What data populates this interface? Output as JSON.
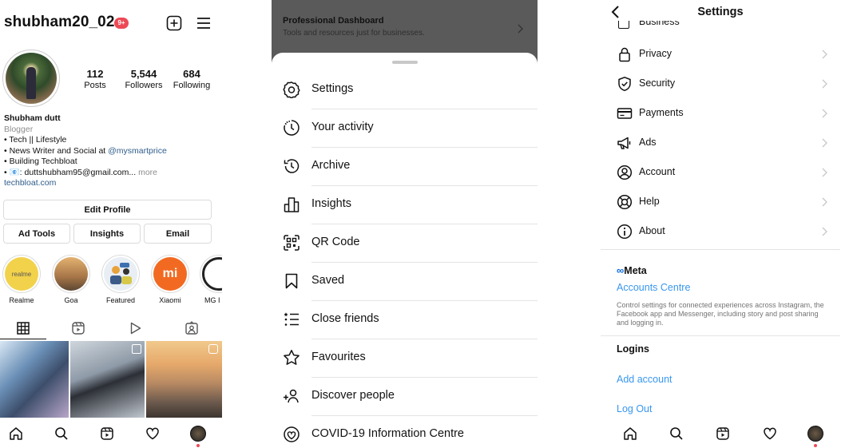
{
  "profile": {
    "username": "shubham20_02",
    "notification_badge": "9+",
    "stats": [
      {
        "value": "112",
        "label": "Posts"
      },
      {
        "value": "5,544",
        "label": "Followers"
      },
      {
        "value": "684",
        "label": "Following"
      }
    ],
    "bio": {
      "name": "Shubham dutt",
      "category": "Blogger",
      "line1": "• Tech || Lifestyle",
      "line2_prefix": "• News Writer and Social at ",
      "line2_mention": "@mysmartprice",
      "line3": "• Building Techbloat",
      "line4": "• 📧: duttshubham95@gmail.com...",
      "line4_more": " more",
      "link": "techbloat.com"
    },
    "buttons": {
      "edit_profile": "Edit Profile",
      "ad_tools": "Ad Tools",
      "insights": "Insights",
      "email": "Email"
    },
    "highlights": [
      {
        "label": "Realme",
        "color": "#f2d24b"
      },
      {
        "label": "Goa",
        "color": "#c98b4a"
      },
      {
        "label": "Featured",
        "color": "#e8eef4"
      },
      {
        "label": "Xiaomi",
        "color": "#f26a21"
      },
      {
        "label": "MG I",
        "color": "#222222"
      }
    ],
    "realme_logo_text": "realme",
    "xiaomi_logo_text": "mi"
  },
  "menu": {
    "dim_title": "Professional Dashboard",
    "dim_subtitle": "Tools and resources just for businesses.",
    "items": [
      {
        "label": "Settings",
        "icon": "settings-icon"
      },
      {
        "label": "Your activity",
        "icon": "activity-icon"
      },
      {
        "label": "Archive",
        "icon": "archive-icon"
      },
      {
        "label": "Insights",
        "icon": "insights-icon"
      },
      {
        "label": "QR Code",
        "icon": "qr-code-icon"
      },
      {
        "label": "Saved",
        "icon": "saved-icon"
      },
      {
        "label": "Close friends",
        "icon": "close-friends-icon"
      },
      {
        "label": "Favourites",
        "icon": "star-icon"
      },
      {
        "label": "Discover people",
        "icon": "add-person-icon"
      },
      {
        "label": "COVID-19 Information Centre",
        "icon": "covid-info-icon"
      }
    ]
  },
  "settings": {
    "title": "Settings",
    "partial_item": "Business",
    "items": [
      {
        "label": "Privacy",
        "icon": "lock-icon"
      },
      {
        "label": "Security",
        "icon": "shield-icon"
      },
      {
        "label": "Payments",
        "icon": "card-icon"
      },
      {
        "label": "Ads",
        "icon": "megaphone-icon"
      },
      {
        "label": "Account",
        "icon": "account-icon"
      },
      {
        "label": "Help",
        "icon": "help-icon"
      },
      {
        "label": "About",
        "icon": "info-icon"
      }
    ],
    "meta_label": "Meta",
    "accounts_centre": "Accounts Centre",
    "accounts_desc": "Control settings for connected experiences across Instagram, the Facebook app and Messenger, including story and post sharing and logging in.",
    "logins_label": "Logins",
    "add_account": "Add account",
    "log_out": "Log Out"
  }
}
